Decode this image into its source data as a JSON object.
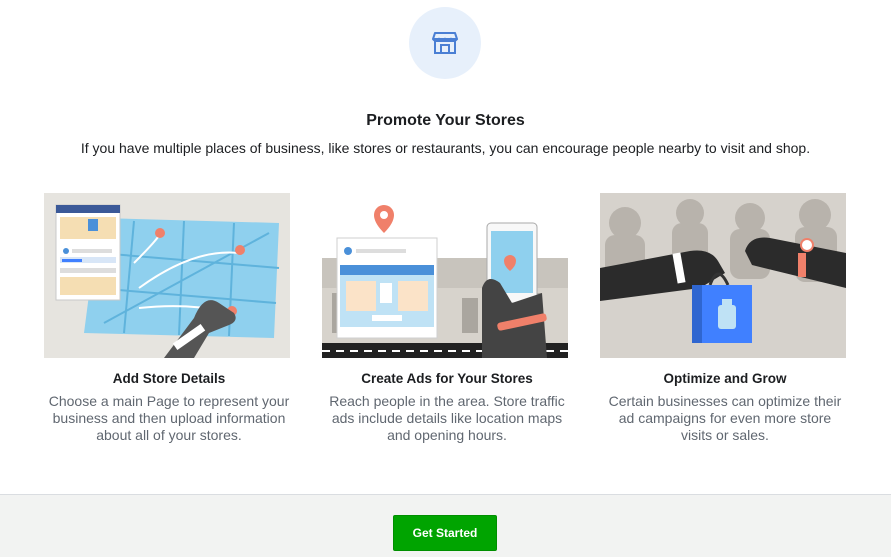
{
  "header": {
    "icon": "store-icon",
    "title": "Promote Your Stores",
    "subtitle": "If you have multiple places of business, like stores or restaurants, you can encourage people nearby to visit and shop."
  },
  "cards": [
    {
      "illustration": "hand-on-map-illustration",
      "title": "Add Store Details",
      "text": "Choose a main Page to represent your business and then upload information about all of your stores."
    },
    {
      "illustration": "storefront-phone-map-illustration",
      "title": "Create Ads for Your Stores",
      "text": "Reach people in the area. Store traffic ads include details like location maps and opening hours."
    },
    {
      "illustration": "shopping-bag-handoff-illustration",
      "title": "Optimize and Grow",
      "text": "Certain businesses can optimize their ad campaigns for even more store visits or sales."
    }
  ],
  "footer": {
    "cta_label": "Get Started"
  },
  "colors": {
    "accent_blue": "#4080ff",
    "pin_salmon": "#f0806a",
    "cta_green": "#00a400",
    "icon_circle": "#e7f0fb"
  }
}
